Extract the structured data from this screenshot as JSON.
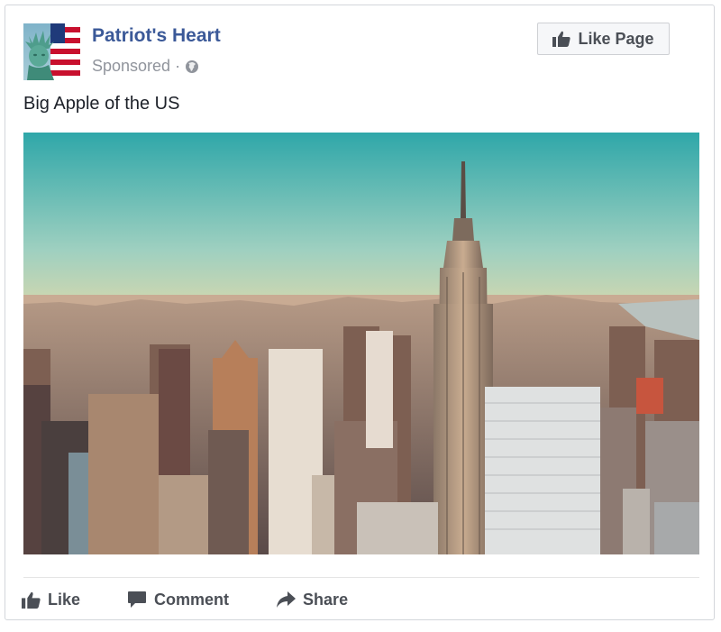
{
  "post": {
    "page_name": "Patriot's Heart",
    "sponsored_label": "Sponsored",
    "separator": "·",
    "like_page_label": "Like Page",
    "caption": "Big Apple of the US",
    "image_subject": "new-york-city-skyline-empire-state-building",
    "icons": {
      "avatar": "statue-of-liberty-flag",
      "privacy": "globe-icon",
      "like": "thumbs-up-icon",
      "comment": "speech-bubble-icon",
      "share": "share-arrow-icon"
    }
  },
  "actions": {
    "like": "Like",
    "comment": "Comment",
    "share": "Share"
  },
  "colors": {
    "brand": "#3b5998",
    "secondary_text": "#90949c",
    "action_text": "#4b4f56",
    "button_bg": "#f6f7f9",
    "border": "#d3d6db"
  }
}
